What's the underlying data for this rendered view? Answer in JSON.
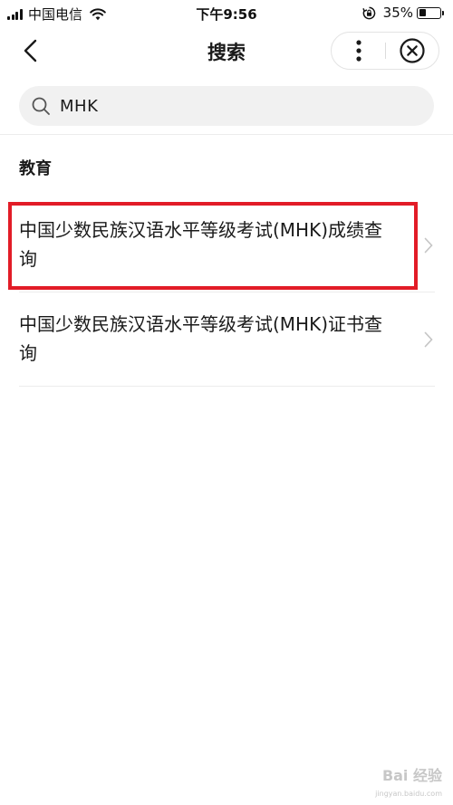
{
  "status_bar": {
    "carrier": "中国电信",
    "time": "下午9:56",
    "battery_percent": "35%",
    "battery_level": 0.35
  },
  "nav": {
    "title": "搜索"
  },
  "search": {
    "query": "MHK"
  },
  "section": {
    "title": "教育"
  },
  "results": [
    {
      "title": "中国少数民族汉语水平等级考试(MHK)成绩查询"
    },
    {
      "title": "中国少数民族汉语水平等级考试(MHK)证书查询"
    }
  ],
  "watermark": {
    "text": "Bai 经验",
    "url": "jingyan.baidu.com"
  },
  "colors": {
    "highlight": "#e21c27",
    "search_bg": "#f1f1f1"
  }
}
